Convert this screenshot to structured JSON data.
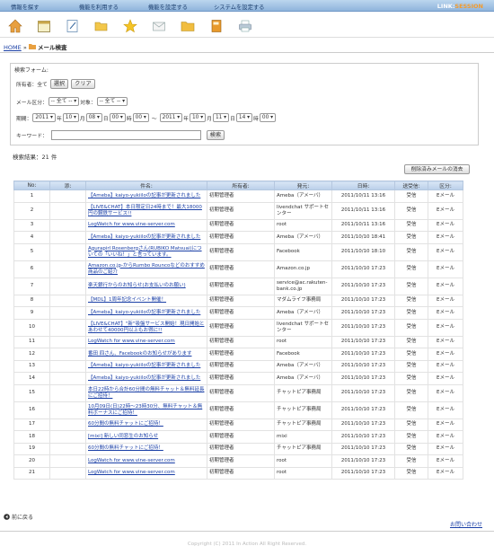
{
  "nav": {
    "items": [
      "情報を探す",
      "機能を利用する",
      "機能を設定する",
      "システムを設定する"
    ],
    "brand_a": "LINK",
    "brand_b": "SESSION"
  },
  "icons": [
    "home-icon",
    "calendar-icon",
    "notepad-icon",
    "folder-open-icon",
    "star-icon",
    "mail-icon",
    "folder-icon",
    "book-icon",
    "printer-icon"
  ],
  "breadcrumb": {
    "home": "HOME",
    "sep": "»",
    "current": "メール検査"
  },
  "form": {
    "legend": "検索フォーム:",
    "owner_label": "所有者：全て",
    "select_btn": "選択",
    "clear_btn": "クリア",
    "mailtype_label": "メール区分：",
    "mailtype_value": "-- 全て --",
    "target_label": "対象：",
    "target_value": "-- 全て --",
    "date_label": "期間：",
    "from": {
      "year": "2011",
      "month": "10",
      "day": "08",
      "hour": "00",
      "min": "00"
    },
    "to": {
      "year": "2011",
      "month": "10",
      "day": "11",
      "hour": "14",
      "min": "00"
    },
    "u_year": "年",
    "u_month": "月",
    "u_day": "日",
    "u_hour": "時",
    "tilde": "～",
    "keyword_label": "キーワード：",
    "search_btn": "検索"
  },
  "result_text": "検索結果：21 件",
  "delete_btn": "削除済みメールの消去",
  "table": {
    "headers": [
      "No:",
      "添:",
      "件名:",
      "所有者:",
      "発元:",
      "日時:",
      "送受信:",
      "区分:"
    ],
    "rows": [
      {
        "no": "1",
        "subject": "【Ameba】kaiyo-yukiiloの記事が更新されました",
        "owner": "初期管理者",
        "from": "Ameba（アメーバ）",
        "date": "2011/10/11 13:16",
        "dir": "受信",
        "type": "Eメール"
      },
      {
        "no": "2",
        "subject": "【LIVE&CHAT】本日限定日24時まで！最大18000円の鋼鉄サービス!!",
        "owner": "初期管理者",
        "from": "livendchat サポートセンター",
        "date": "2011/10/11 13:16",
        "dir": "受信",
        "type": "Eメール"
      },
      {
        "no": "3",
        "subject": "LogWatch for www.vine-server.com",
        "owner": "初期管理者",
        "from": "root",
        "date": "2011/10/11 13:16",
        "dir": "受信",
        "type": "Eメール"
      },
      {
        "no": "4",
        "subject": "【Ameba】kaiyo-yukiiloの記事が更新されました",
        "owner": "初期管理者",
        "from": "Ameba（アメーバ）",
        "date": "2011/10/10 18:41",
        "dir": "受信",
        "type": "Eメール"
      },
      {
        "no": "5",
        "subject": "Agurapirl Rosenbergさん(RUBIKO Matsuai)についての「いいね！」と言っています。",
        "owner": "初期管理者",
        "from": "Facebook",
        "date": "2011/10/10 18:10",
        "dir": "受信",
        "type": "Eメール"
      },
      {
        "no": "6",
        "subject": "Amazon.co.jp-からRumbo Rouncoなどのおすすめ商品のご紹介",
        "owner": "初期管理者",
        "from": "Amazon.co.jp",
        "date": "2011/10/10 17:23",
        "dir": "受信",
        "type": "Eメール"
      },
      {
        "no": "7",
        "subject": "楽天銀行からのお知らせ(お支払いのお願い)",
        "owner": "初期管理者",
        "from": "service@ac.rakuten-bank.co.jp",
        "date": "2011/10/10 17:23",
        "dir": "受信",
        "type": "Eメール"
      },
      {
        "no": "8",
        "subject": "【MDL】1周年記念イベント開催！",
        "owner": "初期管理者",
        "from": "マダムライフ事務局",
        "date": "2011/10/10 17:23",
        "dir": "受信",
        "type": "Eメール"
      },
      {
        "no": "9",
        "subject": "【Ameba】kaiyo-yukiiloの記事が更新されました",
        "owner": "初期管理者",
        "from": "Ameba（アメーバ）",
        "date": "2011/10/10 17:23",
        "dir": "受信",
        "type": "Eメール"
      },
      {
        "no": "10",
        "subject": "【LIVE&CHAT】\"新\"吸盤サービス開始！現日開始とあわせて40000円以上もお得に!!",
        "owner": "初期管理者",
        "from": "livendchat サポートセンター",
        "date": "2011/10/10 17:23",
        "dir": "受信",
        "type": "Eメール"
      },
      {
        "no": "11",
        "subject": "LogWatch for www.vine-server.com",
        "owner": "初期管理者",
        "from": "root",
        "date": "2011/10/10 17:23",
        "dir": "受信",
        "type": "Eメール"
      },
      {
        "no": "12",
        "subject": "番田 四さん、Facebookのお知らせがあります",
        "owner": "初期管理者",
        "from": "Facebook",
        "date": "2011/10/10 17:23",
        "dir": "受信",
        "type": "Eメール"
      },
      {
        "no": "13",
        "subject": "【Ameba】kaiyo-yukiiloの記事が更新されました",
        "owner": "初期管理者",
        "from": "Ameba（アメーバ）",
        "date": "2011/10/10 17:23",
        "dir": "受信",
        "type": "Eメール"
      },
      {
        "no": "14",
        "subject": "【Ameba】kaiyo-yukiiloの記事が更新されました",
        "owner": "初期管理者",
        "from": "Ameba（アメーバ）",
        "date": "2011/10/10 17:23",
        "dir": "受信",
        "type": "Eメール"
      },
      {
        "no": "15",
        "subject": "本日22時から合計60分間の無料チャット＆無料延長にご招待！",
        "owner": "初期管理者",
        "from": "チャットピア事務局",
        "date": "2011/10/10 17:23",
        "dir": "受信",
        "type": "Eメール"
      },
      {
        "no": "16",
        "subject": "10月09日(日)22時～23時30分、無料チャット＆無料ボーナスにご招待！",
        "owner": "初期管理者",
        "from": "チャットピア事務局",
        "date": "2011/10/10 17:23",
        "dir": "受信",
        "type": "Eメール"
      },
      {
        "no": "17",
        "subject": "60分間の無料チャットにご招待！",
        "owner": "初期管理者",
        "from": "チャットピア事務局",
        "date": "2011/10/10 17:23",
        "dir": "受信",
        "type": "Eメール"
      },
      {
        "no": "18",
        "subject": "[mixi] 新しい同窓生のお知らせ",
        "owner": "初期管理者",
        "from": "mixi",
        "date": "2011/10/10 17:23",
        "dir": "受信",
        "type": "Eメール"
      },
      {
        "no": "19",
        "subject": "60分間の無料チャットにご招待！",
        "owner": "初期管理者",
        "from": "チャットピア事務局",
        "date": "2011/10/10 17:23",
        "dir": "受信",
        "type": "Eメール"
      },
      {
        "no": "20",
        "subject": "LogWatch for www.vine-server.com",
        "owner": "初期管理者",
        "from": "root",
        "date": "2011/10/10 17:23",
        "dir": "受信",
        "type": "Eメール"
      },
      {
        "no": "21",
        "subject": "LogWatch for www.vine-server.com",
        "owner": "初期管理者",
        "from": "root",
        "date": "2011/10/10 17:23",
        "dir": "受信",
        "type": "Eメール"
      }
    ]
  },
  "footer": {
    "back": "前に戻る",
    "contact": "お問い合わせ",
    "copyright": "Copyright (C) 2011 In Action All Right Reserved."
  }
}
